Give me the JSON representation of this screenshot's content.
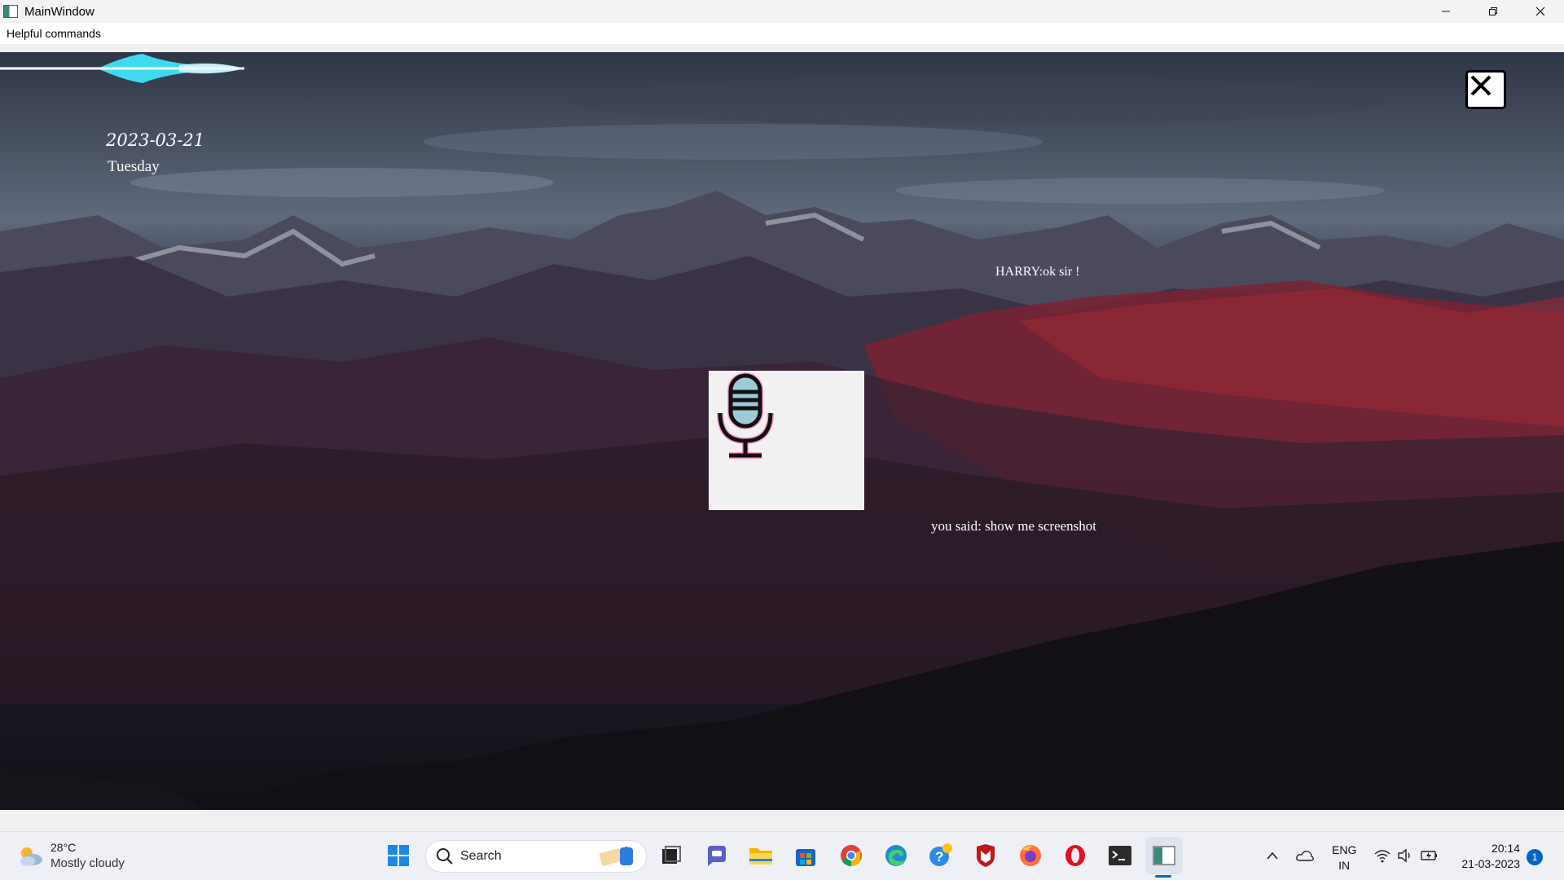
{
  "window": {
    "title": "MainWindow",
    "controls": {
      "minimize": "—",
      "restore": "❐",
      "close": "✕"
    }
  },
  "menubar": {
    "items": [
      "Helpful commands"
    ]
  },
  "main": {
    "date": "2023-03-21",
    "weekday": "Tuesday",
    "assistant_reply": "HARRY:ok sir !",
    "user_said": "you said: show me screenshot",
    "close_icon": "close-icon",
    "mic_icon": "microphone-icon"
  },
  "taskbar": {
    "weather": {
      "temp": "28°C",
      "desc": "Mostly cloudy"
    },
    "search": {
      "label": "Search"
    },
    "pinned_icons": [
      "start-icon",
      "task-view-icon",
      "teams-chat-icon",
      "file-explorer-icon",
      "store-icon",
      "chrome-icon",
      "edge-icon",
      "help-icon",
      "mcafee-icon",
      "firefox-icon",
      "opera-icon",
      "terminal-icon",
      "python-app-icon"
    ],
    "tray": {
      "lang": "ENG",
      "region": "IN",
      "time": "20:14",
      "date": "21-03-2023",
      "notifications": "1"
    }
  },
  "colors": {
    "accent": "#0067c0",
    "wave": "#3fd9f0",
    "mic_glow": "#ff3fa0"
  }
}
